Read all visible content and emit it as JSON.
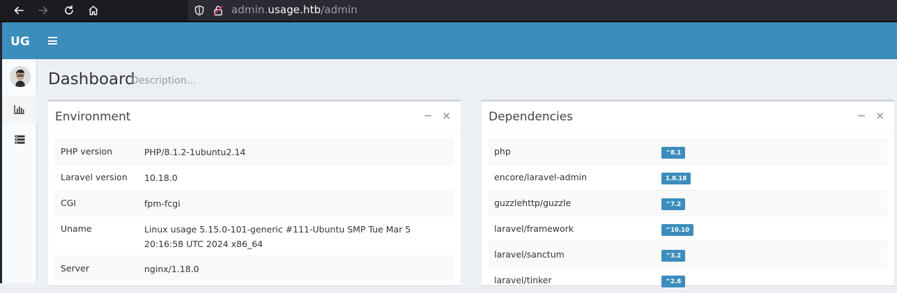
{
  "browser": {
    "url_prefix": "admin.",
    "url_domain": "usage.htb",
    "url_path": "/admin"
  },
  "header": {
    "logo": "UG"
  },
  "page": {
    "title": "Dashboard",
    "description": "Description..."
  },
  "environment": {
    "title": "Environment",
    "rows": [
      {
        "key": "PHP version",
        "value": "PHP/8.1.2-1ubuntu2.14"
      },
      {
        "key": "Laravel version",
        "value": "10.18.0"
      },
      {
        "key": "CGI",
        "value": "fpm-fcgi"
      },
      {
        "key": "Uname",
        "value": "Linux usage 5.15.0-101-generic #111-Ubuntu SMP Tue Mar 5 20:16:58 UTC 2024 x86_64"
      },
      {
        "key": "Server",
        "value": "nginx/1.18.0"
      }
    ]
  },
  "dependencies": {
    "title": "Dependencies",
    "rows": [
      {
        "name": "php",
        "version": "^8.1"
      },
      {
        "name": "encore/laravel-admin",
        "version": "1.8.18"
      },
      {
        "name": "guzzlehttp/guzzle",
        "version": "^7.2"
      },
      {
        "name": "laravel/framework",
        "version": "^10.10"
      },
      {
        "name": "laravel/sanctum",
        "version": "^3.2"
      },
      {
        "name": "laravel/tinker",
        "version": "^2.8"
      }
    ]
  },
  "box_tools": {
    "collapse": "−",
    "remove": "×"
  },
  "colors": {
    "header": "#3c8dbc",
    "badge": "#3c8dbc",
    "browser_chrome": "#1c1b22"
  }
}
